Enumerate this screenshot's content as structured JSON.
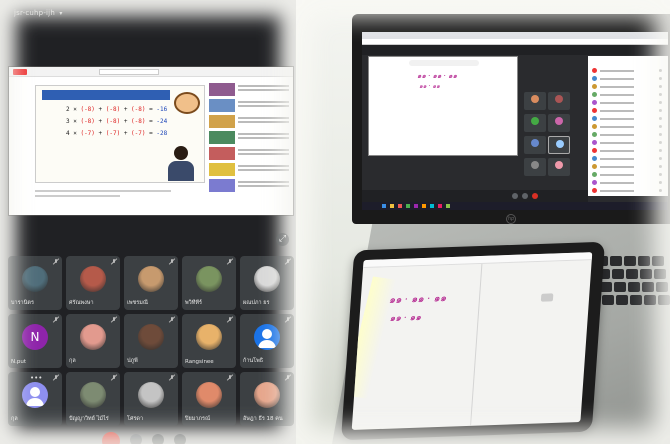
{
  "phone": {
    "meeting_code": "jsr-cuhp-ijh",
    "present_title": "",
    "tiles": [
      {
        "name": "บารานิตร",
        "avatar": "photo",
        "color": "#4f6d7a"
      },
      {
        "name": "ศรัณพงษา",
        "avatar": "photo",
        "color": "#b55a4a"
      },
      {
        "name": "เพชรมณี",
        "avatar": "photo",
        "color": "#c79a6e"
      },
      {
        "name": "พวิทีทีร์",
        "avatar": "photo",
        "color": "#7a9460"
      },
      {
        "name": "ผณปภา ยร",
        "avatar": "photo",
        "color": "#d9d9d9"
      },
      {
        "name": "N.put",
        "avatar": "N",
        "color": "#8e24aa"
      },
      {
        "name": "กุล",
        "avatar": "photo",
        "color": "#e29a8e"
      },
      {
        "name": "ปภูพี",
        "avatar": "photo",
        "color": "#6e4b3a"
      },
      {
        "name": "Rangsinee",
        "avatar": "photo",
        "color": "#e8b26a"
      },
      {
        "name": "ก้านโพธิ",
        "avatar": "person",
        "color": "#1a73e8"
      },
      {
        "name": "กุล",
        "avatar": "person",
        "color": "#8e8ff0"
      },
      {
        "name": "ปัญญาวิทย์ ไม้ไร่",
        "avatar": "photo",
        "color": "#7d8b72"
      },
      {
        "name": "โศรดา",
        "avatar": "photo",
        "color": "#c4c4c4"
      },
      {
        "name": "ปิยมาภรณ์",
        "avatar": "photo",
        "color": "#e08a6a"
      },
      {
        "name": "อัษฎา ธีร 18 คน",
        "avatar": "photo",
        "color": "#e6a68c"
      }
    ]
  },
  "colors": {
    "meet_bg": "#202124",
    "tile_bg": "#3c4043",
    "end_call": "#d93025",
    "ink": "#b01a8a"
  }
}
